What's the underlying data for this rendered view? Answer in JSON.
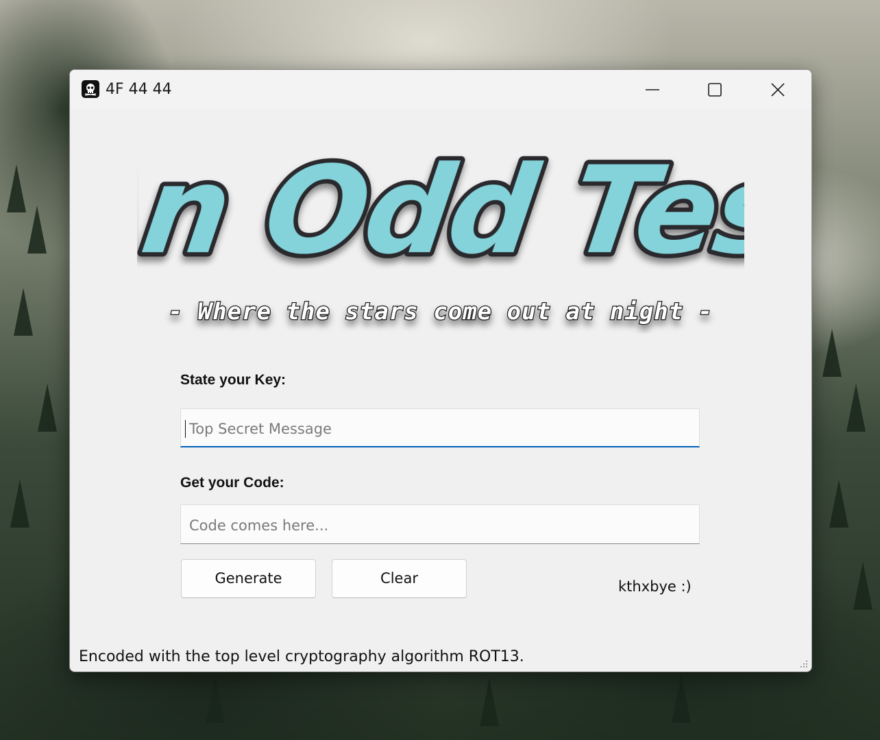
{
  "window": {
    "title": "4F 44 44",
    "icon": "skull-icon"
  },
  "controls": {
    "minimize": "minimize-icon",
    "maximize": "maximize-icon",
    "close": "close-icon"
  },
  "logo": {
    "title": "An Odd Test",
    "subtitle": "- Where the stars come out at night -",
    "fill_color": "#84d3da",
    "outline_color": "#2b2b2e"
  },
  "form": {
    "key_label": "State your Key:",
    "key_placeholder": "Top Secret Message",
    "key_value": "",
    "code_label": "Get your Code:",
    "code_placeholder": "Code comes here...",
    "code_value": "",
    "generate_label": "Generate",
    "clear_label": "Clear",
    "side_text": "kthxbye :)"
  },
  "status": {
    "text": "Encoded with the top level cryptography algorithm ROT13."
  },
  "colors": {
    "accent": "#005fb8",
    "window_bg": "#f0f0f0"
  }
}
